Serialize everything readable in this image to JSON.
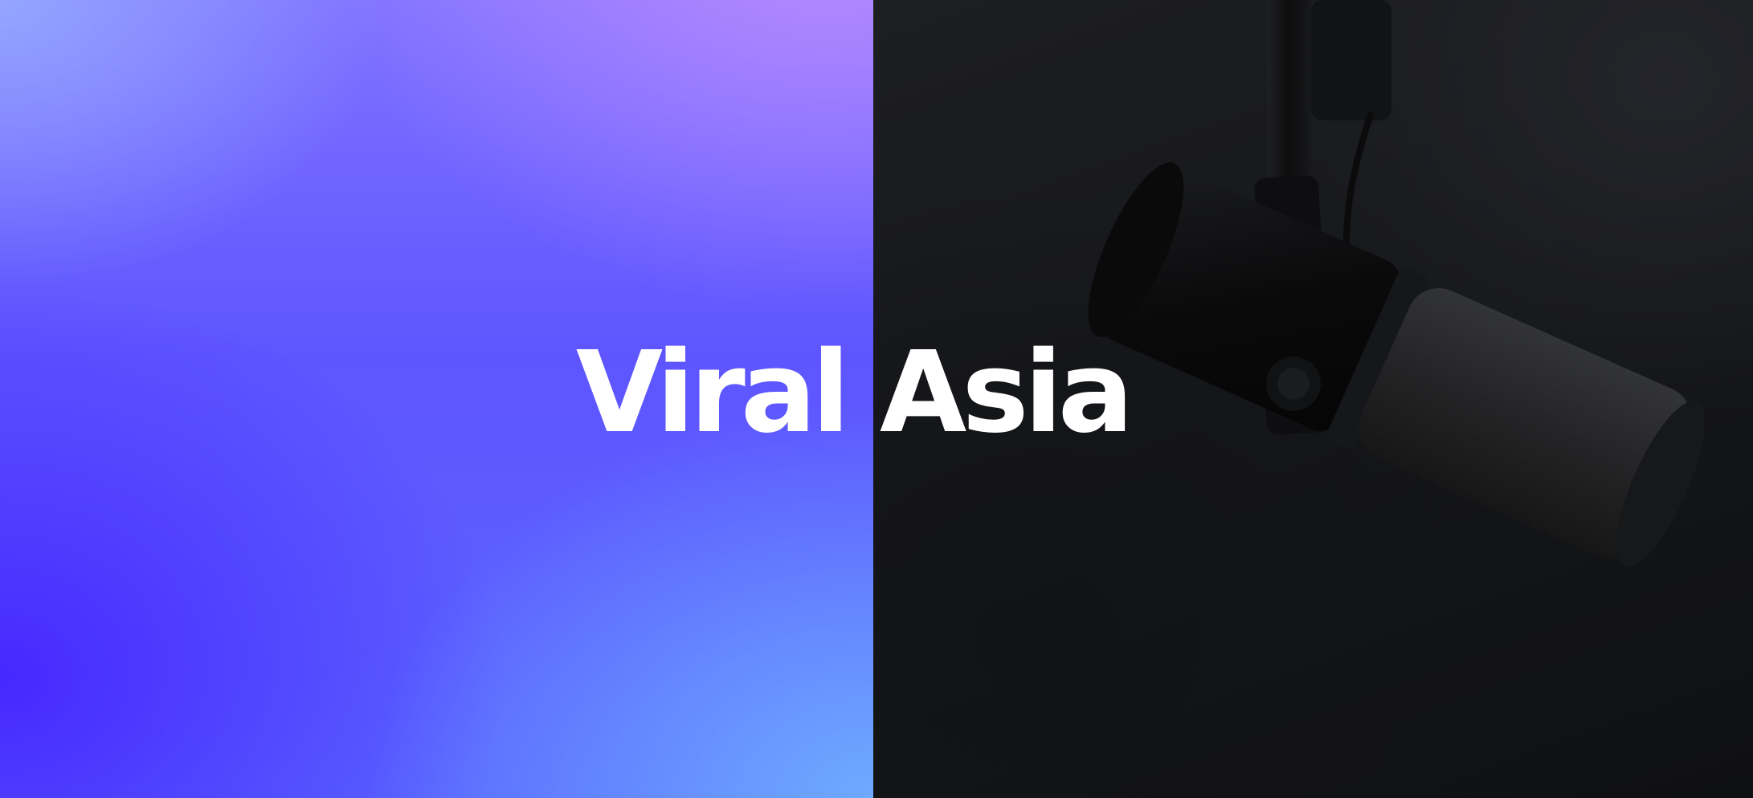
{
  "hero": {
    "title": "Viral Asia",
    "image": {
      "subject": "microphone-image"
    },
    "colors": {
      "gradient_top": "#a98cff",
      "gradient_mid": "#5e55ff",
      "gradient_bottom_left": "#4628ff",
      "gradient_bottom_right": "#6eaaff",
      "photo_background": "#141518",
      "title_color": "#ffffff"
    }
  }
}
